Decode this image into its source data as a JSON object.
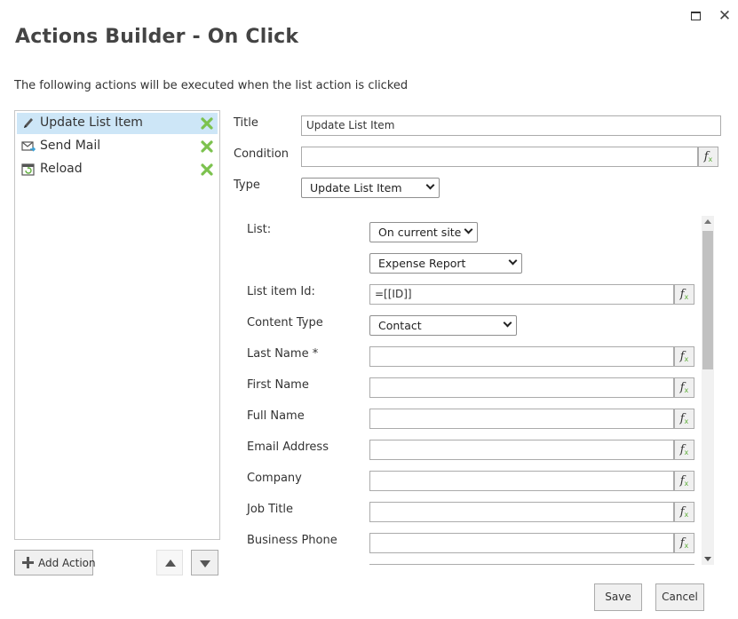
{
  "dialog": {
    "title": "Actions Builder - On Click",
    "subtitle": "The following actions will be executed when the list action is clicked",
    "maximize_icon": "window-maximize-icon",
    "close_icon": "window-close-icon"
  },
  "actions": {
    "items": [
      {
        "label": "Update List Item",
        "icon": "pencil-icon",
        "selected": true
      },
      {
        "label": "Send Mail",
        "icon": "mail-icon",
        "selected": false
      },
      {
        "label": "Reload",
        "icon": "reload-icon",
        "selected": false
      }
    ],
    "add_label": "Add Action"
  },
  "form": {
    "title_label": "Title",
    "title_value": "Update List Item",
    "condition_label": "Condition",
    "condition_value": "",
    "type_label": "Type",
    "type_value": "Update List Item",
    "fx_label": "f"
  },
  "details": {
    "list_label": "List:",
    "site_value": "On current site",
    "list_value": "Expense Report",
    "item_id_label": "List item Id:",
    "item_id_value": "=[[ID]]",
    "content_type_label": "Content Type",
    "content_type_value": "Contact",
    "fields": [
      {
        "label": "Last Name *",
        "value": ""
      },
      {
        "label": "First Name",
        "value": ""
      },
      {
        "label": "Full Name",
        "value": ""
      },
      {
        "label": "Email Address",
        "value": ""
      },
      {
        "label": "Company",
        "value": ""
      },
      {
        "label": "Job Title",
        "value": ""
      },
      {
        "label": "Business Phone",
        "value": ""
      }
    ]
  },
  "footer": {
    "save_label": "Save",
    "cancel_label": "Cancel"
  },
  "colors": {
    "selected_bg": "#cde6f7",
    "delete_green": "#7cc24e"
  }
}
